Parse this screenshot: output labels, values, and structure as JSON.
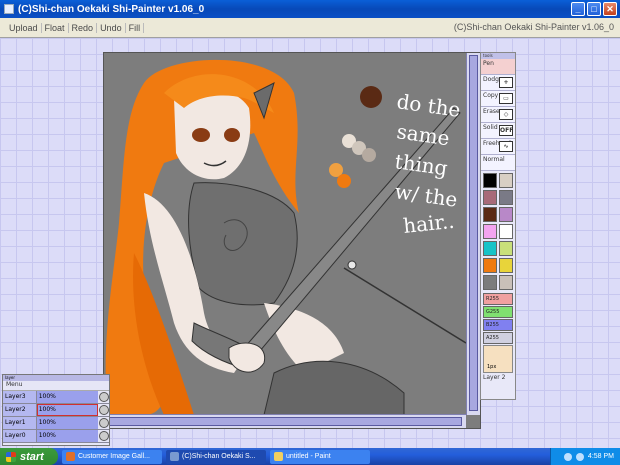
{
  "window": {
    "title": "(C)Shi-chan Oekaki Shi-Painter v1.06_0",
    "controls": [
      "_",
      "□",
      "✕"
    ]
  },
  "menubar": {
    "items": [
      "Upload",
      "Float",
      "Redo",
      "Undo",
      "Fill"
    ],
    "title_right": "(C)Shi-chan Oekaki Shi-Painter v1.06_0"
  },
  "canvas": {
    "handwriting": [
      "do the",
      "same",
      "thing",
      "w/ the",
      "hair.."
    ]
  },
  "tools": {
    "header": "tools",
    "items": [
      {
        "label": "Pen",
        "icon": "pen-icon"
      },
      {
        "label": "Dodge",
        "icon": "plus-box-icon"
      },
      {
        "label": "Copy",
        "icon": "copy-icon"
      },
      {
        "label": "Eraser",
        "icon": "eraser-icon"
      },
      {
        "label": "Solid",
        "icon": "off-toggle-icon",
        "icon_text": "OFF"
      },
      {
        "label": "Freehand",
        "icon": "freehand-icon"
      }
    ],
    "mode": "Normal",
    "swatches": [
      "#000000",
      "#d8cfc4",
      "#a86a78",
      "#7a7a86",
      "#5a2a14",
      "#b888c8",
      "#f3a4f0",
      "#ffffff",
      "#17c3c8",
      "#c9e07a",
      "#f07a10",
      "#e8d43a",
      "#7c7c7c",
      "#c9c0b8"
    ],
    "sliders": [
      {
        "label": "R255",
        "color": "#f0a0a0"
      },
      {
        "label": "G255",
        "color": "#80e070"
      },
      {
        "label": "B255",
        "color": "#8080f0"
      },
      {
        "label": "A255",
        "color": "#d0d0e0"
      }
    ],
    "size": "1px",
    "layer": "Layer 2"
  },
  "layers": {
    "header": "layer",
    "menu": "Menu",
    "rows": [
      {
        "name": "Layer3",
        "opacity": "100%"
      },
      {
        "name": "Layer2",
        "opacity": "100%"
      },
      {
        "name": "Layer1",
        "opacity": "100%"
      },
      {
        "name": "Layer0",
        "opacity": "100%"
      }
    ]
  },
  "taskbar": {
    "start": "start",
    "tasks": [
      {
        "label": "Customer Image Gall...",
        "icon_color": "#e0702a"
      },
      {
        "label": "(C)Shi-chan Oekaki S...",
        "icon_color": "#7a9ad0"
      },
      {
        "label": "untitled - Paint",
        "icon_color": "#f0d060"
      }
    ],
    "clock": "4:58 PM"
  }
}
